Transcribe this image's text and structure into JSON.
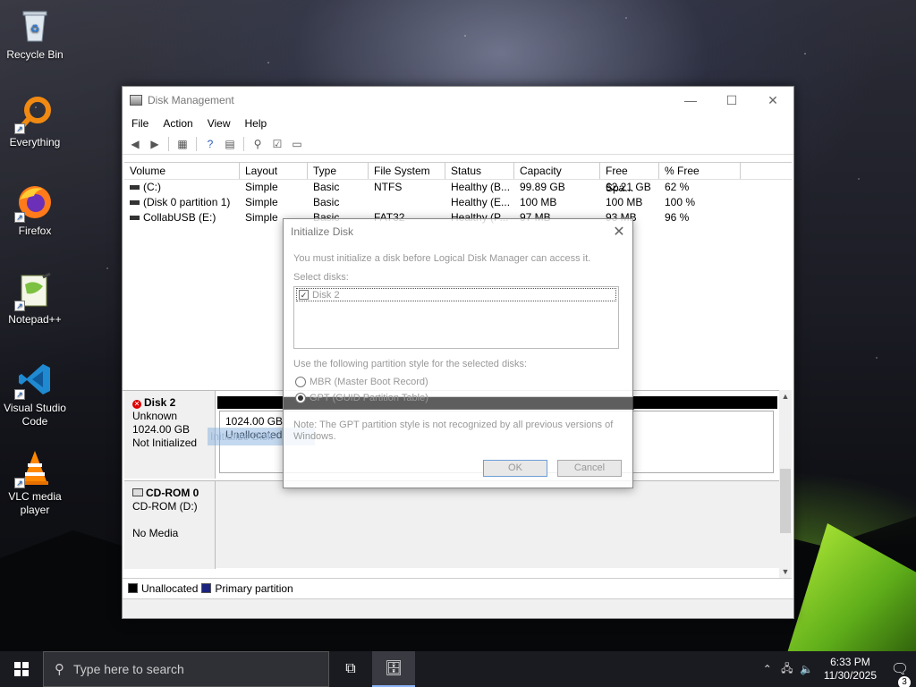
{
  "desktop": {
    "icons": [
      {
        "label": "Recycle Bin",
        "icon": "recycle-bin-icon"
      },
      {
        "label": "Everything",
        "icon": "everything-search-icon"
      },
      {
        "label": "Firefox",
        "icon": "firefox-icon"
      },
      {
        "label": "Notepad++",
        "icon": "notepadpp-icon"
      },
      {
        "label": "Visual Studio Code",
        "icon": "vscode-icon"
      },
      {
        "label": "VLC media player",
        "icon": "vlc-icon"
      }
    ]
  },
  "window": {
    "title": "Disk Management",
    "menu": [
      "File",
      "Action",
      "View",
      "Help"
    ],
    "columns": [
      "Volume",
      "Layout",
      "Type",
      "File System",
      "Status",
      "Capacity",
      "Free Spa...",
      "% Free"
    ],
    "volumes": [
      {
        "volume": "(C:)",
        "layout": "Simple",
        "type": "Basic",
        "fs": "NTFS",
        "status": "Healthy (B...",
        "capacity": "99.89 GB",
        "free": "62.21 GB",
        "pct": "62 %"
      },
      {
        "volume": "(Disk 0 partition 1)",
        "layout": "Simple",
        "type": "Basic",
        "fs": "",
        "status": "Healthy (E...",
        "capacity": "100 MB",
        "free": "100 MB",
        "pct": "100 %"
      },
      {
        "volume": "CollabUSB (E:)",
        "layout": "Simple",
        "type": "Basic",
        "fs": "FAT32",
        "status": "Healthy (P...",
        "capacity": "97 MB",
        "free": "93 MB",
        "pct": "96 %"
      }
    ],
    "disks": [
      {
        "name": "Disk 2",
        "kind": "Unknown",
        "size": "1024.00 GB",
        "state": "Not Initialized",
        "partition_size": "1024.00 GB",
        "partition_state": "Unallocated"
      },
      {
        "name": "CD-ROM 0",
        "kind": "CD-ROM (D:)",
        "size": "",
        "state": "No Media"
      }
    ],
    "drag_ghost": "Initialize Disk",
    "legend": [
      "Unallocated",
      "Primary partition"
    ],
    "legend_colors": [
      "#000000",
      "#1a237e"
    ]
  },
  "dialog": {
    "title": "Initialize Disk",
    "intro": "You must initialize a disk before Logical Disk Manager can access it.",
    "select_label": "Select disks:",
    "disk_item": "Disk 2",
    "disk_checked": true,
    "partition_label": "Use the following partition style for the selected disks:",
    "mbr": "MBR (Master Boot Record)",
    "gpt": "GPT (GUID Partition Table)",
    "selected_style": "GPT",
    "note": "Note: The GPT partition style is not recognized by all previous versions of Windows.",
    "ok": "OK",
    "cancel": "Cancel"
  },
  "taskbar": {
    "search_placeholder": "Type here to search",
    "time": "6:33 PM",
    "date": "11/30/2025",
    "notification_count": "3"
  }
}
